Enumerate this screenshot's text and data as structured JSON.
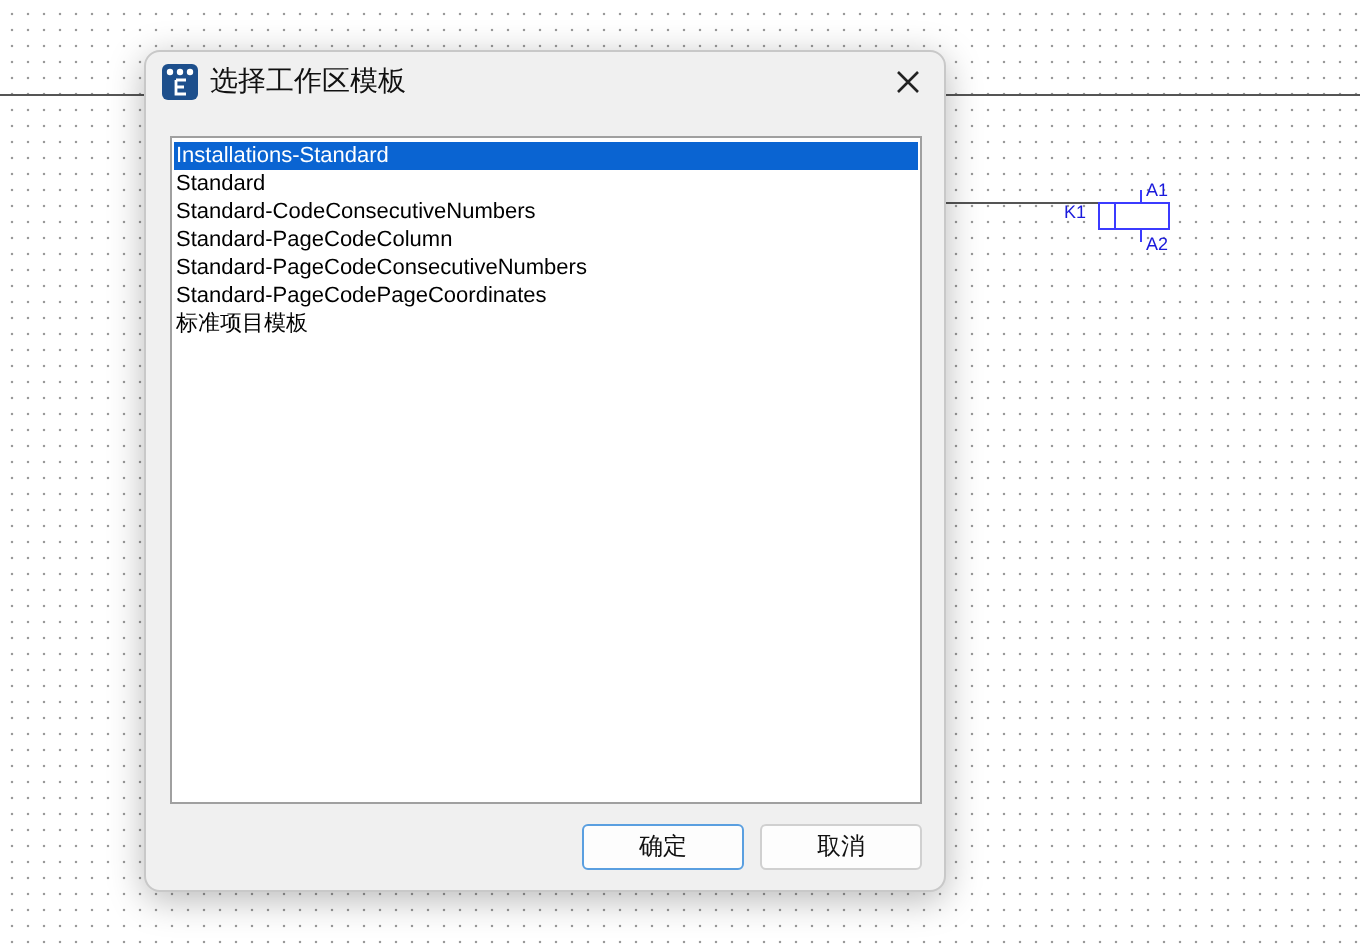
{
  "canvas": {
    "component": {
      "name": "K1",
      "pin_top": "A1",
      "pin_bottom": "A2"
    }
  },
  "dialog": {
    "title": "选择工作区模板",
    "templates": [
      {
        "label": "Installations-Standard",
        "selected": true
      },
      {
        "label": "Standard",
        "selected": false
      },
      {
        "label": "Standard-CodeConsecutiveNumbers",
        "selected": false
      },
      {
        "label": "Standard-PageCodeColumn",
        "selected": false
      },
      {
        "label": "Standard-PageCodeConsecutiveNumbers",
        "selected": false
      },
      {
        "label": "Standard-PageCodePageCoordinates",
        "selected": false
      },
      {
        "label": "标准项目模板",
        "selected": false
      }
    ],
    "buttons": [
      {
        "label": "确定",
        "default": true
      },
      {
        "label": "取消",
        "default": false
      }
    ]
  }
}
